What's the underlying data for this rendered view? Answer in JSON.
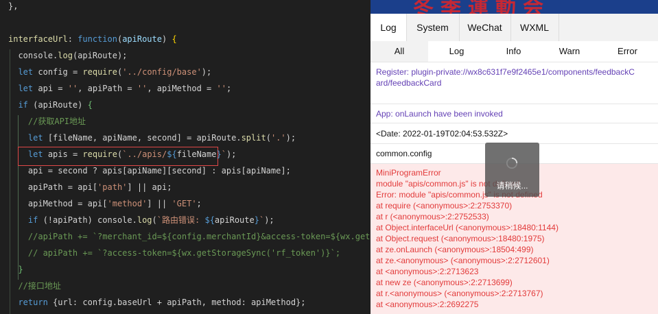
{
  "editor": {
    "lines": [
      {
        "tokens": [
          [
            "t-plain",
            "},"
          ]
        ]
      },
      {
        "tokens": []
      },
      {
        "tokens": [
          [
            "t-prop",
            "interfaceUrl"
          ],
          [
            "t-plain",
            ": "
          ],
          [
            "t-kw",
            "function"
          ],
          [
            "t-plain",
            "("
          ],
          [
            "t-var",
            "apiRoute"
          ],
          [
            "t-plain",
            ") "
          ],
          [
            "t-br",
            "{"
          ]
        ]
      },
      {
        "tokens": [
          [
            "t-plain",
            "  console."
          ],
          [
            "t-fn",
            "log"
          ],
          [
            "t-plain",
            "(apiRoute);"
          ]
        ]
      },
      {
        "tokens": [
          [
            "t-plain",
            "  "
          ],
          [
            "t-kw",
            "let"
          ],
          [
            "t-plain",
            " config = "
          ],
          [
            "t-fn",
            "require"
          ],
          [
            "t-plain",
            "("
          ],
          [
            "t-str",
            "'../config/base'"
          ],
          [
            "t-plain",
            ");"
          ]
        ]
      },
      {
        "tokens": [
          [
            "t-plain",
            "  "
          ],
          [
            "t-kw",
            "let"
          ],
          [
            "t-plain",
            " api = "
          ],
          [
            "t-str",
            "''"
          ],
          [
            "t-plain",
            ", apiPath = "
          ],
          [
            "t-str",
            "''"
          ],
          [
            "t-plain",
            ", apiMethod = "
          ],
          [
            "t-str",
            "''"
          ],
          [
            "t-plain",
            ";"
          ]
        ]
      },
      {
        "tokens": [
          [
            "t-plain",
            "  "
          ],
          [
            "t-kw",
            "if"
          ],
          [
            "t-plain",
            " (apiRoute) "
          ],
          [
            "t-brg",
            "{"
          ]
        ]
      },
      {
        "tokens": [
          [
            "t-com",
            "    //获取API地址"
          ]
        ]
      },
      {
        "tokens": [
          [
            "t-plain",
            "    "
          ],
          [
            "t-kw",
            "let"
          ],
          [
            "t-plain",
            " [fileName, apiName, second] = apiRoute."
          ],
          [
            "t-fn",
            "split"
          ],
          [
            "t-plain",
            "("
          ],
          [
            "t-str",
            "'.'"
          ],
          [
            "t-plain",
            ");"
          ]
        ]
      },
      {
        "tokens": [
          [
            "t-plain",
            "    "
          ],
          [
            "t-kw",
            "let"
          ],
          [
            "t-plain",
            " apis = "
          ],
          [
            "t-fn",
            "require"
          ],
          [
            "t-plain",
            "("
          ],
          [
            "t-str",
            "`../apis/"
          ],
          [
            "t-kw",
            "${"
          ],
          [
            "t-plain",
            "fileName"
          ],
          [
            "t-kw",
            "}"
          ],
          [
            "t-str",
            "`"
          ],
          [
            "t-plain",
            ");"
          ]
        ]
      },
      {
        "tokens": [
          [
            "t-plain",
            "    api = second ? apis[apiName][second] : apis[apiName];"
          ]
        ]
      },
      {
        "tokens": [
          [
            "t-plain",
            "    apiPath = api["
          ],
          [
            "t-str",
            "'path'"
          ],
          [
            "t-plain",
            "] || api;"
          ]
        ]
      },
      {
        "tokens": [
          [
            "t-plain",
            "    apiMethod = api["
          ],
          [
            "t-str",
            "'method'"
          ],
          [
            "t-plain",
            "] || "
          ],
          [
            "t-str",
            "'GET'"
          ],
          [
            "t-plain",
            ";"
          ]
        ]
      },
      {
        "tokens": [
          [
            "t-plain",
            "    "
          ],
          [
            "t-kw",
            "if"
          ],
          [
            "t-plain",
            " (!apiPath) console."
          ],
          [
            "t-fn",
            "log"
          ],
          [
            "t-plain",
            "("
          ],
          [
            "t-str",
            "`路由错误: "
          ],
          [
            "t-kw",
            "${"
          ],
          [
            "t-plain",
            "apiRoute"
          ],
          [
            "t-kw",
            "}"
          ],
          [
            "t-str",
            "`"
          ],
          [
            "t-plain",
            ");"
          ]
        ]
      },
      {
        "tokens": [
          [
            "t-com",
            "    //apiPath += `?merchant_id=${config.merchantId}&access-token=${wx.getStorageSync('rf_token')}`;"
          ]
        ]
      },
      {
        "tokens": [
          [
            "t-com",
            "    // apiPath += `?access-token=${wx.getStorageSync('rf_token')}`;"
          ]
        ]
      },
      {
        "tokens": [
          [
            "t-plain",
            "  "
          ],
          [
            "t-brg",
            "}"
          ]
        ]
      },
      {
        "tokens": [
          [
            "t-com",
            "  //接口地址"
          ]
        ]
      },
      {
        "tokens": [
          [
            "t-plain",
            "  "
          ],
          [
            "t-kw",
            "return"
          ],
          [
            "t-plain",
            " {url: config.baseUrl + apiPath, method: apiMethod};"
          ]
        ]
      }
    ]
  },
  "devtools": {
    "banner_text": "冬季運動会",
    "tabs": [
      "Log",
      "System",
      "WeChat",
      "WXML"
    ],
    "active_tab": "Log",
    "filters": [
      "All",
      "Log",
      "Info",
      "Warn",
      "Error"
    ],
    "active_filter": "All",
    "entries": {
      "register": "Register: plugin-private://wx8c631f7e9f2465e1/components/feedbackCard/feedbackCard",
      "app": "App: onLaunch have been invoked",
      "date": "<Date: 2022-01-19T02:04:53.532Z>",
      "config": "common.config"
    },
    "error_lines": [
      "MiniProgramError",
      "module \"apis/common.js\" is not defined",
      "Error: module \"apis/common.js\" is not defined",
      "at require (<anonymous>:2:2753370)",
      "at r (<anonymous>:2:2752533)",
      "at Object.interfaceUrl (<anonymous>:18480:1144)",
      "at Object.request (<anonymous>:18480:1975)",
      "at ze.onLaunch (<anonymous>:18504:499)",
      "at ze.<anonymous> (<anonymous>:2:2712601)",
      "at <anonymous>:2:2713623",
      "at new ze (<anonymous>:2:2713699)",
      "at r.<anonymous> (<anonymous>:2:2713767)",
      "at <anonymous>:2:2692275"
    ],
    "toast_text": "请稍候..."
  }
}
